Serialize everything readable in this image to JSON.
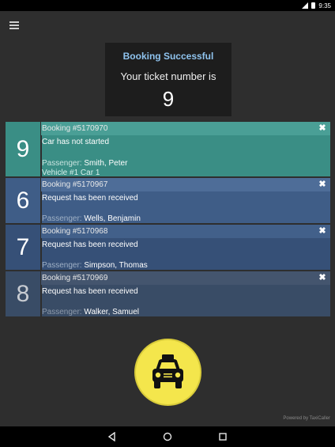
{
  "status_bar": {
    "time": "9:35"
  },
  "success": {
    "title": "Booking Successful",
    "subtitle": "Your ticket number is",
    "ticket": "9"
  },
  "bookings": [
    {
      "ticket": "9",
      "booking": "Booking #5170970",
      "status": "Car has not started",
      "passenger_label": "Passenger:",
      "passenger": "Smith, Peter",
      "vehicle": "Vehicle #1 Car 1",
      "color": "#3a8e85"
    },
    {
      "ticket": "6",
      "booking": "Booking #5170967",
      "status": "Request has been received",
      "passenger_label": "Passenger:",
      "passenger": "Wells, Benjamin",
      "color": "#3f5d87"
    },
    {
      "ticket": "7",
      "booking": "Booking #5170968",
      "status": "Request has been received",
      "passenger_label": "Passenger:",
      "passenger": "Simpson, Thomas",
      "color": "#365077"
    },
    {
      "ticket": "8",
      "booking": "Booking #5170969",
      "status": "Request has been received",
      "passenger_label": "Passenger:",
      "passenger": "Walker, Samuel",
      "color": "#394c66"
    }
  ],
  "close_glyph": "✖",
  "taxi_button": {
    "icon": "taxi-icon",
    "color": "#f4e64c"
  },
  "powered_by": "Powered by TaxiCaller",
  "nav_bar": {
    "back_icon": "back-icon",
    "home_icon": "home-icon",
    "recents_icon": "recents-icon"
  }
}
